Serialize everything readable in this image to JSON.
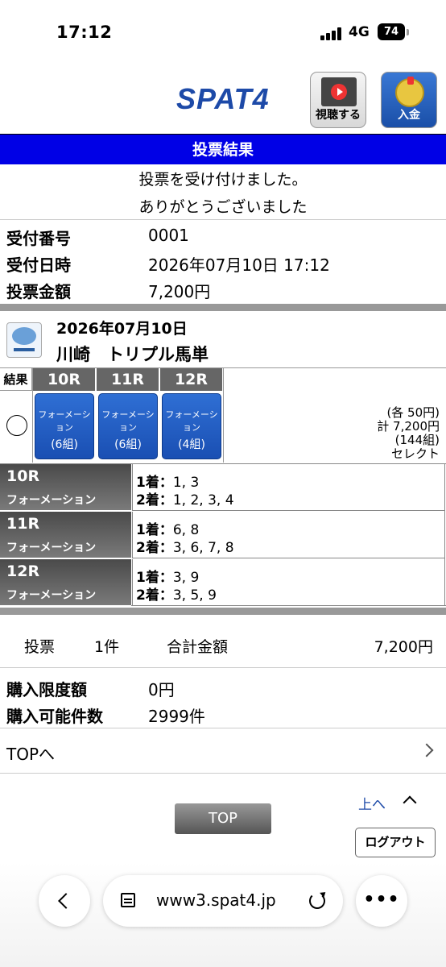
{
  "status_bar": {
    "time": "17:12",
    "network": "4G",
    "battery": "74"
  },
  "header": {
    "logo": "SPAT4",
    "watch_label": "視聴する",
    "deposit_label": "入金"
  },
  "page_title": "投票結果",
  "messages": [
    "投票を受け付けました。",
    "ありがとうございました"
  ],
  "receipt": {
    "number_label": "受付番号",
    "number_value": "0001",
    "datetime_label": "受付日時",
    "datetime_value": "2026年07月10日 17:12",
    "amount_label": "投票金額",
    "amount_value": "7,200円"
  },
  "race": {
    "date": "2026年07月10日",
    "name": "川崎　トリプル馬単",
    "result_label": "結果",
    "columns": [
      {
        "race": "10R",
        "type": "フォーメーション",
        "count": "(6組)"
      },
      {
        "race": "11R",
        "type": "フォーメーション",
        "count": "(6組)"
      },
      {
        "race": "12R",
        "type": "フォーメーション",
        "count": "(4組)"
      }
    ],
    "summary": {
      "each": "(各 50円)",
      "total": "計 7,200円",
      "combos": "(144組)",
      "mode": "セレクト"
    }
  },
  "selections": [
    {
      "race": "10R",
      "type": "フォーメーション",
      "first_label": "1着：",
      "first": "1, 3",
      "second_label": "2着：",
      "second": "1, 2, 3, 4"
    },
    {
      "race": "11R",
      "type": "フォーメーション",
      "first_label": "1着：",
      "first": "6, 8",
      "second_label": "2着：",
      "second": "3, 6, 7, 8"
    },
    {
      "race": "12R",
      "type": "フォーメーション",
      "first_label": "1着：",
      "first": "3, 9",
      "second_label": "2着：",
      "second": "3, 5, 9"
    }
  ],
  "totals": {
    "vote_label": "投票",
    "vote_count": "1件",
    "sum_label": "合計金額",
    "sum_value": "7,200円"
  },
  "limits": {
    "limit_label": "購入限度額",
    "limit_value": "0円",
    "possible_label": "購入可能件数",
    "possible_value": "2999件"
  },
  "nav": {
    "top_link": "TOPへ",
    "up_link": "上へ",
    "top_button": "TOP",
    "logout_button": "ログアウト"
  },
  "browser": {
    "url": "www3.spat4.jp"
  }
}
